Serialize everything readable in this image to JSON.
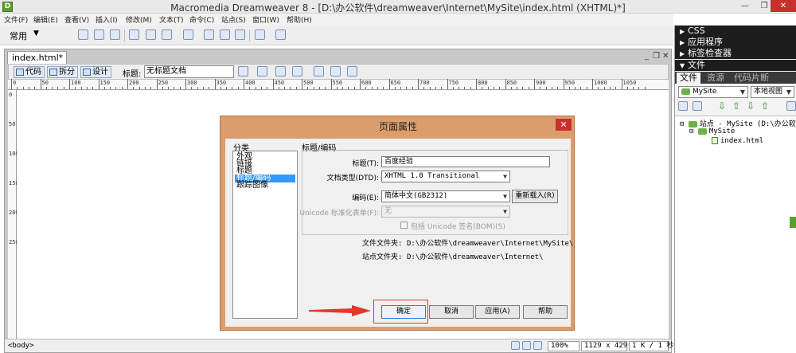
{
  "app": {
    "logo_letter": "D",
    "title": "Macromedia Dreamweaver 8 - [D:\\办公软件\\dreamweaver\\Internet\\MySite\\index.html (XHTML)*]",
    "window_controls": {
      "minimize": "—",
      "maximize": "❐",
      "close": "✕"
    }
  },
  "menubar": {
    "items": [
      "文件(F)",
      "编辑(E)",
      "查看(V)",
      "插入(I)",
      "修改(M)",
      "文本(T)",
      "命令(C)",
      "站点(S)",
      "窗口(W)",
      "帮助(H)"
    ]
  },
  "insert_toolbar": {
    "category": "常用",
    "arrow": "▼"
  },
  "document": {
    "tab_label": "index.html*",
    "window_controls": {
      "minimize": "_",
      "restore": "❐",
      "close": "✕"
    },
    "view_buttons": {
      "code": "代码",
      "split": "拆分",
      "design": "设计"
    },
    "title_label": "标题:",
    "title_value": "无标题文档",
    "ruler_h_labels": [
      "0",
      "50",
      "100",
      "150",
      "200",
      "250",
      "300",
      "350",
      "400",
      "450",
      "500",
      "550",
      "600",
      "650",
      "700",
      "750",
      "800",
      "850",
      "900",
      "950",
      "1000",
      "1050"
    ],
    "ruler_v_labels": [
      "0",
      "50",
      "100",
      "150",
      "200",
      "250"
    ],
    "status": {
      "tag": "<body>",
      "zoom": "100%",
      "size": "1129 x 429",
      "download": "1 K / 1 秒"
    }
  },
  "panels": {
    "headers": [
      "CSS",
      "应用程序",
      "标签检查器",
      "文件"
    ],
    "file_tabs": [
      "文件",
      "资源",
      "代码片断"
    ],
    "site_select": "MySite",
    "view_select": "本地视图",
    "tree": {
      "root": "站点 - MySite (D:\\办公软件",
      "folder": "MySite",
      "file": "index.html"
    }
  },
  "dialog": {
    "title": "页面属性",
    "close": "✕",
    "category_label": "分类",
    "categories": [
      "外观",
      "链接",
      "标题",
      "标题/编码",
      "跟踪图像"
    ],
    "selected_category": 3,
    "section_title": "标题/编码",
    "fields": {
      "title_label": "标题(T):",
      "title_value": "百度经验",
      "doctype_label": "文档类型(DTD):",
      "doctype_value": "XHTML 1.0 Transitional",
      "encoding_label": "编码(E):",
      "encoding_value": "简体中文(GB2312)",
      "reload_button": "重新载入(R)",
      "unicode_label": "Unicode 标准化表单(F):",
      "unicode_value": "无",
      "bom_label": "包括 Unicode 签名(BOM)(S)"
    },
    "paths": {
      "doc_folder_label": "文件文件夹:",
      "doc_folder_value": "D:\\办公软件\\dreamweaver\\Internet\\MySite\\",
      "site_folder_label": "站点文件夹:",
      "site_folder_value": "D:\\办公软件\\dreamweaver\\Internet\\"
    },
    "buttons": {
      "ok": "确定",
      "cancel": "取消",
      "apply": "应用(A)",
      "help": "帮助"
    }
  },
  "colors": {
    "dialog_frame": "#dc9d6d",
    "close_red": "#c7302c",
    "annotation_red": "#e03a2a",
    "selection_blue": "#3399ff"
  }
}
